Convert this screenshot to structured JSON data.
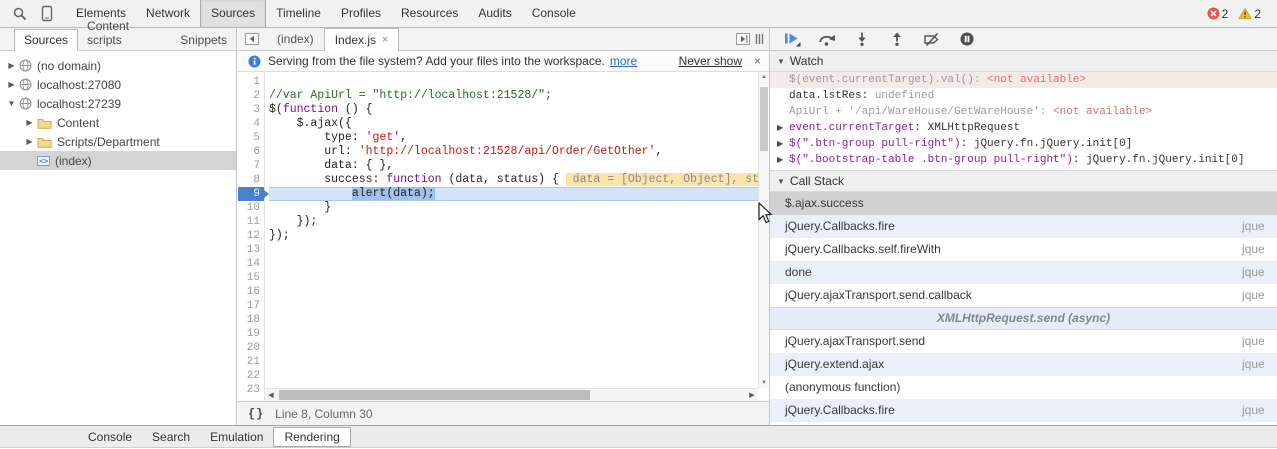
{
  "toolbar": {
    "tabs": [
      "Elements",
      "Network",
      "Sources",
      "Timeline",
      "Profiles",
      "Resources",
      "Audits",
      "Console"
    ],
    "selected_tab": "Sources",
    "error_count": "2",
    "warning_count": "2"
  },
  "sidebar": {
    "tabs": [
      "Sources",
      "Content scripts",
      "Snippets"
    ],
    "selected_tab": "Sources",
    "tree": [
      {
        "label": "(no domain)",
        "icon": "globe",
        "arrow": "right",
        "indent": 0,
        "selected": false
      },
      {
        "label": "localhost:27080",
        "icon": "globe",
        "arrow": "right",
        "indent": 0,
        "selected": false
      },
      {
        "label": "localhost:27239",
        "icon": "globe",
        "arrow": "down",
        "indent": 0,
        "selected": false
      },
      {
        "label": "Content",
        "icon": "folder",
        "arrow": "right",
        "indent": 1,
        "selected": false
      },
      {
        "label": "Scripts/Department",
        "icon": "folder",
        "arrow": "right",
        "indent": 1,
        "selected": false
      },
      {
        "label": "(index)",
        "icon": "file",
        "arrow": "",
        "indent": 1,
        "selected": true
      }
    ]
  },
  "editor": {
    "tabs": [
      {
        "label": "(index)",
        "close": "",
        "active": false
      },
      {
        "label": "Index.js",
        "close": "×",
        "active": true
      }
    ],
    "infobar": {
      "text": "Serving from the file system? Add your files into the workspace.",
      "more_link": "more",
      "never_show": "Never show",
      "close": "×"
    },
    "code": {
      "total_lines": 23,
      "exec_line": 9,
      "lines": {
        "2": [
          [
            "cmt",
            "//var ApiUrl = \"http://localhost:21528/\";"
          ]
        ],
        "3": [
          [
            "pln",
            "$("
          ],
          [
            "kw",
            "function"
          ],
          [
            "pln",
            " () {"
          ]
        ],
        "4": [
          [
            "pln",
            "    $.ajax({"
          ]
        ],
        "5": [
          [
            "pln",
            "        type: "
          ],
          [
            "str",
            "'get'"
          ],
          [
            "pln",
            ","
          ]
        ],
        "6": [
          [
            "pln",
            "        url: "
          ],
          [
            "str",
            "'http://localhost:21528/api/Order/GetOther'"
          ],
          [
            "pln",
            ","
          ]
        ],
        "7": [
          [
            "pln",
            "        data: { },"
          ]
        ],
        "8": [
          [
            "pln",
            "        success: "
          ],
          [
            "kw",
            "function"
          ],
          [
            "pln",
            " (data, status) { "
          ],
          [
            "wid",
            " data = [Object, Object], sta"
          ]
        ],
        "9": [
          [
            "pln",
            "            "
          ],
          [
            "exec",
            "alert(data);"
          ]
        ],
        "10": [
          [
            "pln",
            "        }"
          ]
        ],
        "11": [
          [
            "pln",
            "    });"
          ]
        ],
        "12": [
          [
            "pln",
            "});"
          ]
        ]
      }
    },
    "status": {
      "line_col": "Line 8, Column 30"
    }
  },
  "debugger": {
    "buttons": [
      "resume",
      "step-over",
      "step-into",
      "step-out",
      "deactivate-breakpoints",
      "pause-on-exceptions"
    ],
    "watch": {
      "title": "Watch",
      "rows": [
        {
          "expr": "$(event.currentTarget).val()",
          "value": "<not available>",
          "expr_style": "dim",
          "val_style": "na",
          "arrow": false,
          "row_style": "highlight"
        },
        {
          "expr": "data.lstRes",
          "value": "undefined",
          "expr_style": "pln",
          "val_style": "dim",
          "arrow": false,
          "row_style": ""
        },
        {
          "expr": "ApiUrl + '/api/WareHouse/GetWareHouse'",
          "value": "<not available>",
          "expr_style": "dim",
          "val_style": "na",
          "arrow": false,
          "row_style": ""
        },
        {
          "expr": "event.currentTarget",
          "value": "XMLHttpRequest",
          "expr_style": "name",
          "val_style": "pln",
          "arrow": true,
          "row_style": ""
        },
        {
          "expr": "$(\".btn-group pull-right\")",
          "value": "jQuery.fn.jQuery.init[0]",
          "expr_style": "name",
          "val_style": "pln",
          "arrow": true,
          "row_style": ""
        },
        {
          "expr": "$(\".bootstrap-table .btn-group pull-right\")",
          "value": "jQuery.fn.jQuery.init[0]",
          "expr_style": "name",
          "val_style": "pln",
          "arrow": true,
          "row_style": ""
        }
      ]
    },
    "call_stack": {
      "title": "Call Stack",
      "frames": [
        {
          "fn": "$.ajax.success",
          "file": "",
          "state": "selected"
        },
        {
          "fn": "jQuery.Callbacks.fire",
          "file": "jque",
          "state": "alt"
        },
        {
          "fn": "jQuery.Callbacks.self.fireWith",
          "file": "jque",
          "state": ""
        },
        {
          "fn": "done",
          "file": "jque",
          "state": "alt"
        },
        {
          "fn": "jQuery.ajaxTransport.send.callback",
          "file": "jque",
          "state": ""
        },
        {
          "fn": "XMLHttpRequest.send (async)",
          "file": "",
          "state": "async"
        },
        {
          "fn": "jQuery.ajaxTransport.send",
          "file": "jque",
          "state": ""
        },
        {
          "fn": "jQuery.extend.ajax",
          "file": "jque",
          "state": "alt"
        },
        {
          "fn": "(anonymous function)",
          "file": "",
          "state": ""
        },
        {
          "fn": "jQuery.Callbacks.fire",
          "file": "jque",
          "state": "alt"
        }
      ]
    }
  },
  "drawer": {
    "tabs": [
      "Console",
      "Search",
      "Emulation",
      "Rendering"
    ],
    "selected_tab": "Rendering"
  },
  "colors": {
    "execution_line_blue": "#4b80d1",
    "error_red": "#e1594d",
    "warning_yellow": "#fbc02d",
    "link_blue": "#2a66c8"
  }
}
